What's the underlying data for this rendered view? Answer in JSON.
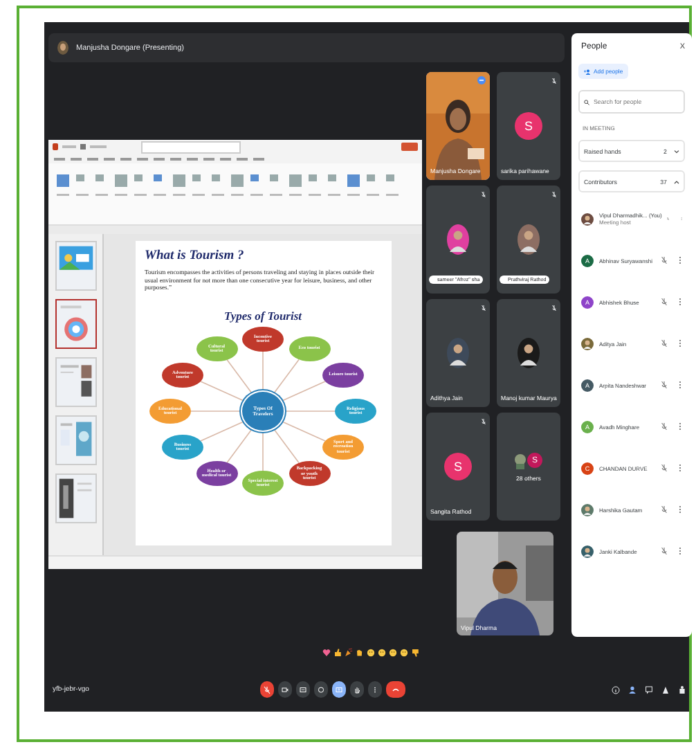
{
  "presenter": {
    "name": "Manjusha Dongare (Presenting)"
  },
  "slide_deck": {
    "thumbnails": [
      {
        "selected": false
      },
      {
        "selected": true
      },
      {
        "selected": false
      },
      {
        "selected": false
      },
      {
        "selected": false
      }
    ],
    "slide": {
      "title": "What is Tourism ?",
      "text": "Tourism encompasses the activities of persons traveling and staying in places outside their usual environment for not more than one consecutive year for leisure, business, and other purposes.”",
      "diagram_title": "Types of Tourist",
      "center": "Types Of Travelers",
      "bubbles": [
        {
          "label": "Incentive tourist",
          "color": "#c0392b"
        },
        {
          "label": "Eco tourist",
          "color": "#8bc34a"
        },
        {
          "label": "Leisure tourist",
          "color": "#7b3fa0"
        },
        {
          "label": "Religious tourist",
          "color": "#29a3c9"
        },
        {
          "label": "Sport and recreation tourist",
          "color": "#f39c33"
        },
        {
          "label": "Backpacking or youth tourist",
          "color": "#c0392b"
        },
        {
          "label": "Special interest tourist",
          "color": "#8bc34a"
        },
        {
          "label": "Health or medical tourist",
          "color": "#7b3fa0"
        },
        {
          "label": "Business tourist",
          "color": "#29a3c9"
        },
        {
          "label": "Educational tourist",
          "color": "#f39c33"
        },
        {
          "label": "Adventure tourist",
          "color": "#c0392b"
        },
        {
          "label": "Cultural tourist",
          "color": "#8bc34a"
        }
      ]
    }
  },
  "tiles": [
    {
      "name": "Manjusha Dongare",
      "kind": "video",
      "speaking": true
    },
    {
      "name": "sarika parihawane",
      "kind": "avatar",
      "initial": "S",
      "color": "#e8336d",
      "speaking": false
    },
    {
      "name": "sameer \"Afroz\" sha",
      "kind": "photo-pill",
      "color": "#e040a0",
      "speaking": false
    },
    {
      "name": "Prathviraj Rathod",
      "kind": "photo-pill",
      "color": "#8d6e63",
      "speaking": false
    },
    {
      "name": "Adithya Jain",
      "color": "#3e4a5a",
      "speaking": false
    },
    {
      "name": "Manoj kumar Maurya",
      "color": "#1a1a1a",
      "speaking": false
    },
    {
      "name": "Sangita Rathod",
      "kind": "avatar",
      "initial": "S",
      "color": "#e8336d",
      "speaking": false
    },
    {
      "name": "28 others",
      "kind": "others",
      "initial": "S",
      "color": "#c2185b",
      "speaking": false
    }
  ],
  "self_view": {
    "name": "Vipul Dharma"
  },
  "people": {
    "title": "People",
    "close": "X",
    "add": "Add people",
    "search_placeholder": "Search for people",
    "section": "IN MEETING",
    "groups": [
      {
        "label": "Raised hands",
        "count": "2",
        "expanded": false
      },
      {
        "label": "Contributors",
        "count": "37",
        "expanded": true
      }
    ],
    "members": [
      {
        "name": "Vipul Dharmadhik... (You)",
        "role": "Meeting host",
        "color": "#6d4c41"
      },
      {
        "name": "Abhinav Suryawanshi",
        "kind": "initial",
        "initial": "A",
        "color": "#1b6b45"
      },
      {
        "name": "Abhishek Bhuse",
        "kind": "initial",
        "initial": "A",
        "color": "#8e44c9"
      },
      {
        "name": "Aditya Jain",
        "color": "#7a6a3a"
      },
      {
        "name": "Arpita Nandeshwar",
        "kind": "initial",
        "initial": "A",
        "color": "#455a64"
      },
      {
        "name": "Avadh Minghare",
        "kind": "initial",
        "initial": "A",
        "color": "#6ab04c"
      },
      {
        "name": "CHANDAN DURVE",
        "kind": "initial",
        "initial": "C",
        "color": "#d84315"
      },
      {
        "name": "Harshika Gautam",
        "color": "#5d7a6a"
      },
      {
        "name": "Janki Kalbande",
        "color": "#37606a"
      }
    ]
  },
  "meeting_code": "yfb-jebr-vgo",
  "controls": [
    {
      "kind": "mic",
      "on": false
    },
    {
      "kind": "camera",
      "on": false
    },
    {
      "kind": "captions",
      "on": false
    },
    {
      "kind": "reactions",
      "on": false
    },
    {
      "kind": "present",
      "on": true
    },
    {
      "kind": "hand",
      "on": false
    },
    {
      "kind": "more",
      "on": false
    },
    {
      "kind": "leave"
    }
  ],
  "side_buttons": [
    {
      "kind": "info",
      "selected": false
    },
    {
      "kind": "people",
      "selected": true
    },
    {
      "kind": "chat",
      "selected": false
    },
    {
      "kind": "activities",
      "selected": false
    },
    {
      "kind": "host",
      "selected": false
    }
  ]
}
